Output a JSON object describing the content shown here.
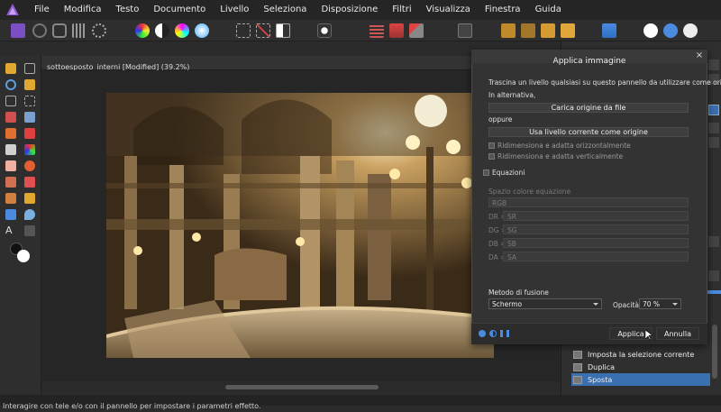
{
  "menubar": {
    "items": [
      "File",
      "Modifica",
      "Testo",
      "Documento",
      "Livello",
      "Seleziona",
      "Disposizione",
      "Filtri",
      "Visualizza",
      "Finestra",
      "Guida"
    ]
  },
  "document": {
    "tab_title": "sottoesposto_interni [Modified] (39.2%)"
  },
  "status_bar": {
    "text": "Interagire con tele e/o con il pannello per impostare i parametri effetto."
  },
  "history": {
    "items": [
      {
        "label": "Imposta la selezione corrente",
        "selected": false
      },
      {
        "label": "Duplica",
        "selected": false
      },
      {
        "label": "Sposta",
        "selected": true
      }
    ]
  },
  "dialog": {
    "title": "Applica immagine",
    "instructions": "Trascina un livello qualsiasi su questo pannello da utilizzare come origine.",
    "alt_label": "In alternativa,",
    "load_button": "Carica origine da file",
    "or_label": "oppure",
    "use_current_button": "Usa livello corrente come origine",
    "resize_h_label": "Ridimensiona e adatta orizzontalmente",
    "resize_v_label": "Ridimensiona e adatta verticalmente",
    "equations_label": "Equazioni",
    "color_space_label": "Spazio colore equazione",
    "color_space_value": "RGB",
    "eq_rows": [
      {
        "label": "DR =",
        "value": "SR"
      },
      {
        "label": "DG =",
        "value": "SG"
      },
      {
        "label": "DB =",
        "value": "SB"
      },
      {
        "label": "DA =",
        "value": "SA"
      }
    ],
    "blend_label": "Metodo di fusione",
    "blend_value": "Schermo",
    "opacity_label": "Opacità:",
    "opacity_value": "70 %",
    "apply_button": "Applica",
    "cancel_button": "Annulla"
  },
  "colors": {
    "accent": "#3a6fb0",
    "brand": "#8a5ad0"
  }
}
